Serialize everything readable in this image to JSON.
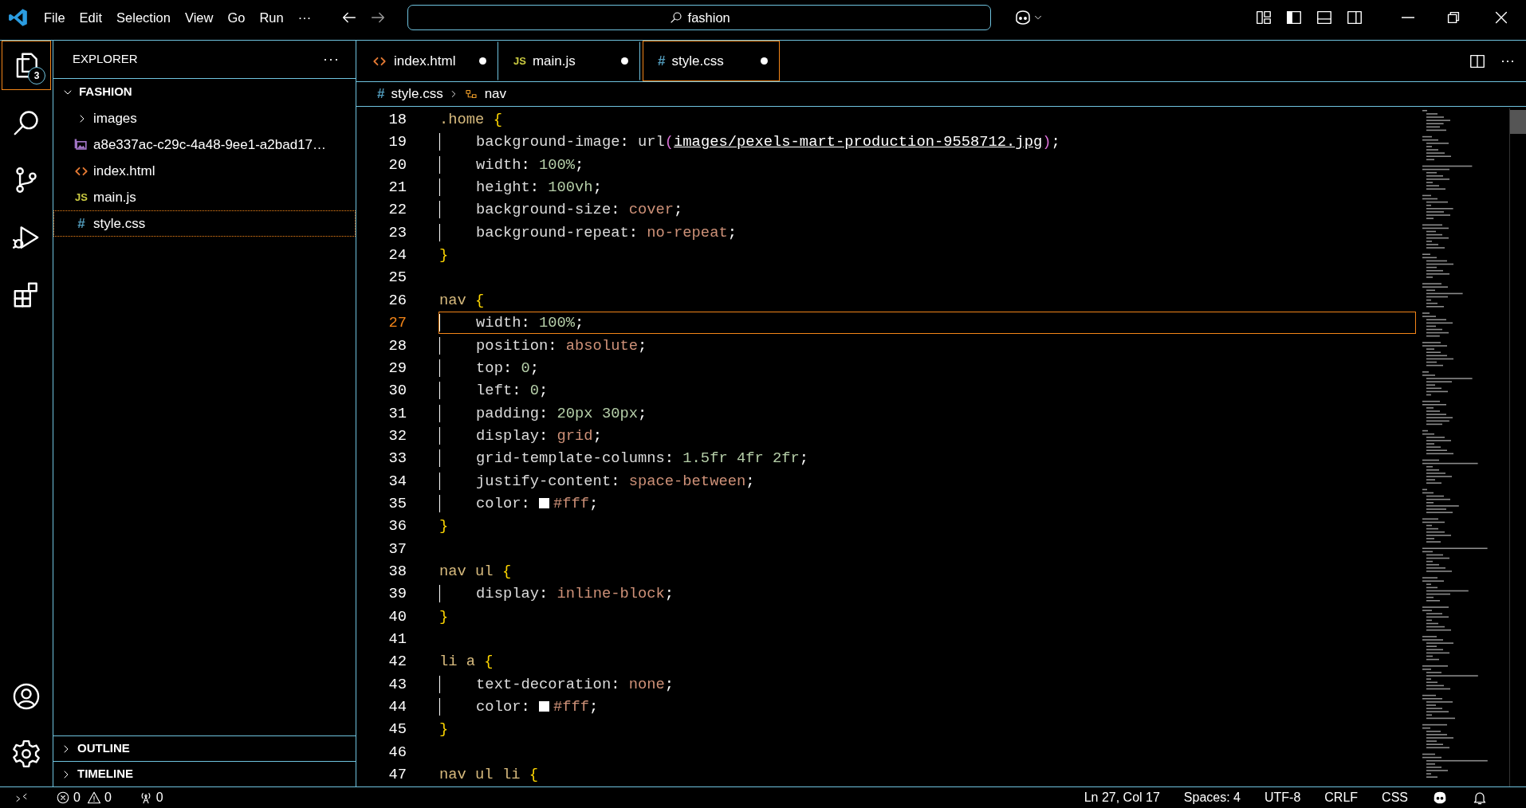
{
  "title_bar": {
    "menu": [
      "File",
      "Edit",
      "Selection",
      "View",
      "Go",
      "Run"
    ],
    "more": "···",
    "search": {
      "value": "fashion"
    }
  },
  "activity_bar": {
    "items": [
      {
        "selected": true,
        "badge": "3"
      },
      {
        "selected": false
      },
      {
        "selected": false
      },
      {
        "selected": false
      },
      {
        "selected": false
      }
    ]
  },
  "sidebar": {
    "title": "EXPLORER",
    "more": "···",
    "folder": {
      "name": "FASHION",
      "expanded": true,
      "children": [
        {
          "kind": "folder",
          "name": "images",
          "expanded": false,
          "selected": false
        },
        {
          "kind": "image",
          "name": "a8e337ac-c29c-4a48-9ee1-a2bad17…",
          "selected": false
        },
        {
          "kind": "html",
          "name": "index.html",
          "selected": false
        },
        {
          "kind": "js",
          "icon": "JS",
          "name": "main.js",
          "selected": false
        },
        {
          "kind": "css",
          "icon": "#",
          "name": "style.css",
          "selected": true
        }
      ]
    },
    "sections": [
      {
        "title": "OUTLINE",
        "expanded": false
      },
      {
        "title": "TIMELINE",
        "expanded": false
      }
    ]
  },
  "tabs": [
    {
      "kind": "html",
      "name": "index.html",
      "selected": false,
      "modified": true
    },
    {
      "kind": "js",
      "icon": "JS",
      "name": "main.js",
      "selected": false,
      "modified": true
    },
    {
      "kind": "css",
      "icon": "#",
      "name": "style.css",
      "selected": true,
      "modified": true
    }
  ],
  "editor_actions": {
    "more": "···"
  },
  "breadcrumb": [
    {
      "kind": "css",
      "icon": "#",
      "label": "style.css"
    },
    {
      "kind": "symbol",
      "label": "nav"
    }
  ],
  "code": [
    {
      "number": "18",
      "current": false,
      "indented": false,
      "tokens": [
        {
          "kind": "sel",
          "text": ".home "
        },
        {
          "kind": "brace",
          "text": "{"
        }
      ]
    },
    {
      "number": "19",
      "current": false,
      "indented": true,
      "tokens": [
        {
          "kind": "prop",
          "text": "background-image"
        },
        {
          "kind": "punct",
          "text": ": "
        },
        {
          "kind": "prop",
          "text": "url"
        },
        {
          "kind": "paren",
          "text": "("
        },
        {
          "kind": "link",
          "text": "images/pexels-mart-production-9558712.jpg"
        },
        {
          "kind": "paren",
          "text": ")"
        },
        {
          "kind": "punct",
          "text": ";"
        }
      ]
    },
    {
      "number": "20",
      "current": false,
      "indented": true,
      "tokens": [
        {
          "kind": "prop",
          "text": "width"
        },
        {
          "kind": "punct",
          "text": ": "
        },
        {
          "kind": "num",
          "text": "100%"
        },
        {
          "kind": "punct",
          "text": ";"
        }
      ]
    },
    {
      "number": "21",
      "current": false,
      "indented": true,
      "tokens": [
        {
          "kind": "prop",
          "text": "height"
        },
        {
          "kind": "punct",
          "text": ": "
        },
        {
          "kind": "num",
          "text": "100vh"
        },
        {
          "kind": "punct",
          "text": ";"
        }
      ]
    },
    {
      "number": "22",
      "current": false,
      "indented": true,
      "tokens": [
        {
          "kind": "prop",
          "text": "background-size"
        },
        {
          "kind": "punct",
          "text": ": "
        },
        {
          "kind": "kw",
          "text": "cover"
        },
        {
          "kind": "punct",
          "text": ";"
        }
      ]
    },
    {
      "number": "23",
      "current": false,
      "indented": true,
      "tokens": [
        {
          "kind": "prop",
          "text": "background-repeat"
        },
        {
          "kind": "punct",
          "text": ": "
        },
        {
          "kind": "kw",
          "text": "no-repeat"
        },
        {
          "kind": "punct",
          "text": ";"
        }
      ]
    },
    {
      "number": "24",
      "current": false,
      "indented": false,
      "tokens": [
        {
          "kind": "brace",
          "text": "}"
        }
      ]
    },
    {
      "number": "25",
      "current": false
    },
    {
      "number": "26",
      "current": false,
      "indented": false,
      "tokens": [
        {
          "kind": "sel",
          "text": "nav "
        },
        {
          "kind": "brace",
          "text": "{"
        }
      ]
    },
    {
      "number": "27",
      "current": true,
      "indented": true,
      "tokens": [
        {
          "kind": "prop",
          "text": "width"
        },
        {
          "kind": "punct",
          "text": ": "
        },
        {
          "kind": "num",
          "text": "100%"
        },
        {
          "kind": "punct",
          "text": ";"
        }
      ]
    },
    {
      "number": "28",
      "current": false,
      "indented": true,
      "tokens": [
        {
          "kind": "prop",
          "text": "position"
        },
        {
          "kind": "punct",
          "text": ": "
        },
        {
          "kind": "kw",
          "text": "absolute"
        },
        {
          "kind": "punct",
          "text": ";"
        }
      ]
    },
    {
      "number": "29",
      "current": false,
      "indented": true,
      "tokens": [
        {
          "kind": "prop",
          "text": "top"
        },
        {
          "kind": "punct",
          "text": ": "
        },
        {
          "kind": "num",
          "text": "0"
        },
        {
          "kind": "punct",
          "text": ";"
        }
      ]
    },
    {
      "number": "30",
      "current": false,
      "indented": true,
      "tokens": [
        {
          "kind": "prop",
          "text": "left"
        },
        {
          "kind": "punct",
          "text": ": "
        },
        {
          "kind": "num",
          "text": "0"
        },
        {
          "kind": "punct",
          "text": ";"
        }
      ]
    },
    {
      "number": "31",
      "current": false,
      "indented": true,
      "tokens": [
        {
          "kind": "prop",
          "text": "padding"
        },
        {
          "kind": "punct",
          "text": ": "
        },
        {
          "kind": "num",
          "text": "20px 30px"
        },
        {
          "kind": "punct",
          "text": ";"
        }
      ]
    },
    {
      "number": "32",
      "current": false,
      "indented": true,
      "tokens": [
        {
          "kind": "prop",
          "text": "display"
        },
        {
          "kind": "punct",
          "text": ": "
        },
        {
          "kind": "kw",
          "text": "grid"
        },
        {
          "kind": "punct",
          "text": ";"
        }
      ]
    },
    {
      "number": "33",
      "current": false,
      "indented": true,
      "tokens": [
        {
          "kind": "prop",
          "text": "grid-template-columns"
        },
        {
          "kind": "punct",
          "text": ": "
        },
        {
          "kind": "num",
          "text": "1.5fr 4fr 2fr"
        },
        {
          "kind": "punct",
          "text": ";"
        }
      ]
    },
    {
      "number": "34",
      "current": false,
      "indented": true,
      "tokens": [
        {
          "kind": "prop",
          "text": "justify-content"
        },
        {
          "kind": "punct",
          "text": ": "
        },
        {
          "kind": "kw",
          "text": "space-between"
        },
        {
          "kind": "punct",
          "text": ";"
        }
      ]
    },
    {
      "number": "35",
      "current": false,
      "indented": true,
      "tokens": [
        {
          "kind": "prop",
          "text": "color"
        },
        {
          "kind": "punct",
          "text": ": "
        },
        {
          "kind": "swatch",
          "color": "#ffffff"
        },
        {
          "kind": "kw",
          "text": "#fff"
        },
        {
          "kind": "punct",
          "text": ";"
        }
      ]
    },
    {
      "number": "36",
      "current": false,
      "indented": false,
      "tokens": [
        {
          "kind": "brace",
          "text": "}"
        }
      ]
    },
    {
      "number": "37",
      "current": false
    },
    {
      "number": "38",
      "current": false,
      "indented": false,
      "tokens": [
        {
          "kind": "sel",
          "text": "nav ul "
        },
        {
          "kind": "brace",
          "text": "{"
        }
      ]
    },
    {
      "number": "39",
      "current": false,
      "indented": true,
      "tokens": [
        {
          "kind": "prop",
          "text": "display"
        },
        {
          "kind": "punct",
          "text": ": "
        },
        {
          "kind": "kw",
          "text": "inline-block"
        },
        {
          "kind": "punct",
          "text": ";"
        }
      ]
    },
    {
      "number": "40",
      "current": false,
      "indented": false,
      "tokens": [
        {
          "kind": "brace",
          "text": "}"
        }
      ]
    },
    {
      "number": "41",
      "current": false
    },
    {
      "number": "42",
      "current": false,
      "indented": false,
      "tokens": [
        {
          "kind": "sel",
          "text": "li a "
        },
        {
          "kind": "brace",
          "text": "{"
        }
      ]
    },
    {
      "number": "43",
      "current": false,
      "indented": true,
      "tokens": [
        {
          "kind": "prop",
          "text": "text-decoration"
        },
        {
          "kind": "punct",
          "text": ": "
        },
        {
          "kind": "kw",
          "text": "none"
        },
        {
          "kind": "punct",
          "text": ";"
        }
      ]
    },
    {
      "number": "44",
      "current": false,
      "indented": true,
      "tokens": [
        {
          "kind": "prop",
          "text": "color"
        },
        {
          "kind": "punct",
          "text": ": "
        },
        {
          "kind": "swatch",
          "color": "#ffffff"
        },
        {
          "kind": "kw",
          "text": "#fff"
        },
        {
          "kind": "punct",
          "text": ";"
        }
      ]
    },
    {
      "number": "45",
      "current": false,
      "indented": false,
      "tokens": [
        {
          "kind": "brace",
          "text": "}"
        }
      ]
    },
    {
      "number": "46",
      "current": false
    },
    {
      "number": "47",
      "current": false,
      "indented": false,
      "tokens": [
        {
          "kind": "sel",
          "text": "nav ul li "
        },
        {
          "kind": "brace",
          "text": "{"
        }
      ]
    }
  ],
  "status_bar": {
    "errors": "0",
    "warnings": "0",
    "ports": "0",
    "items": [
      "Ln 27, Col 17",
      "Spaces: 4",
      "UTF-8",
      "CRLF",
      "CSS"
    ]
  }
}
